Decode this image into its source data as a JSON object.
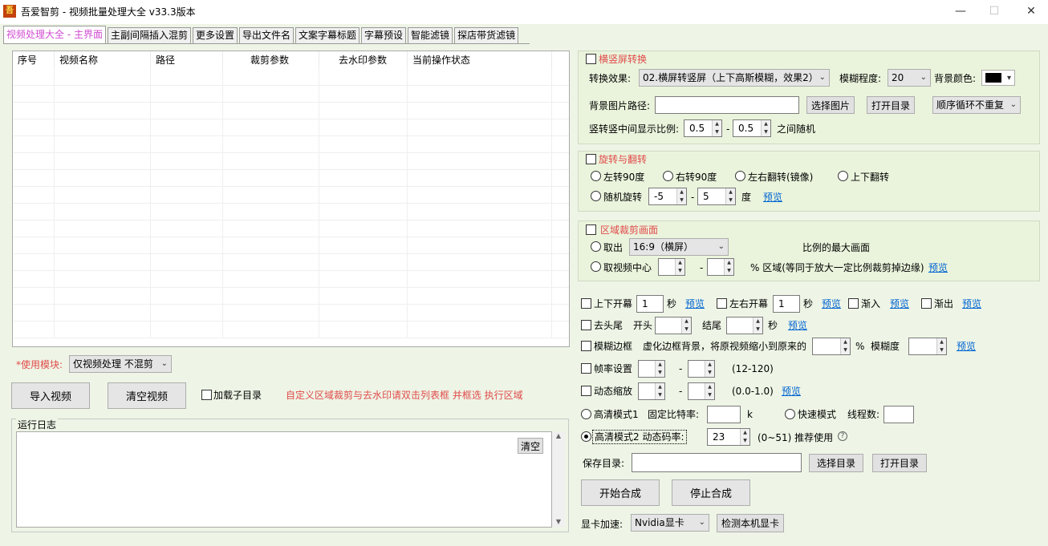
{
  "window": {
    "title": "吾爱智剪 -  视频批量处理大全  v33.3版本",
    "logo": "吾",
    "min": "—",
    "max": "☐",
    "close": "✕"
  },
  "tabs": [
    "视频处理大全 - 主界面",
    "主副间隔插入混剪",
    "更多设置",
    "导出文件名",
    "文案字幕标题",
    "字幕预设",
    "智能滤镜",
    "探店带货滤镜"
  ],
  "table": {
    "columns": [
      "序号",
      "视频名称",
      "路径",
      "裁剪参数",
      "去水印参数",
      "当前操作状态"
    ]
  },
  "left": {
    "module_label": "*使用模块:",
    "module_value": "仅视频处理 不混剪",
    "import_btn": "导入视频",
    "clear_btn": "清空视频",
    "subdir_label": "加载子目录",
    "hint": "自定义区域裁剪与去水印请双击列表框 并框选 执行区域",
    "log_title": "运行日志",
    "log_clear": "清空"
  },
  "g1": {
    "title": "横竖屏转换",
    "effect_label": "转换效果:",
    "effect_value": "02.横屏转竖屏（上下高斯模糊，效果2）",
    "blur_label": "模糊程度:",
    "blur_value": "20",
    "bg_color_label": "背景颜色:",
    "bg_path_label": "背景图片路径:",
    "choose_img": "选择图片",
    "open_dir": "打开目录",
    "loop_value": "顺序循环不重复",
    "ratio_label": "竖转竖中间显示比例:",
    "ratio_a": "0.5",
    "dash": "-",
    "ratio_b": "0.5",
    "ratio_suffix": "之间随机"
  },
  "g2": {
    "title": "旋转与翻转",
    "left90": "左转90度",
    "right90": "右转90度",
    "mirror": "左右翻转(镜像)",
    "flip": "上下翻转",
    "random": "随机旋转",
    "ra": "-5",
    "dash": "-",
    "rb": "5",
    "deg": "度",
    "preview": "预览"
  },
  "g3": {
    "title": "区域裁剪画面",
    "take": "取出",
    "ratio_value": "16:9（横屏）",
    "max_label": "比例的最大画面",
    "center": "取视频中心",
    "dash": "-",
    "pct_label": "% 区域(等同于放大一定比例裁剪掉边缘)",
    "preview": "预览"
  },
  "opts": {
    "open_ud": "上下开幕",
    "open_ud_v": "1",
    "sec": "秒",
    "preview": "预览",
    "open_lr": "左右开幕",
    "open_lr_v": "1",
    "fade_in": "渐入",
    "fade_out": "渐出",
    "trim": "去头尾",
    "head": "开头",
    "tail": "结尾",
    "blur_border": "模糊边框",
    "blur_desc": "虚化边框背景，将原视频缩小到原来的",
    "pct": "%",
    "blur_deg": "模糊度",
    "fps": "帧率设置",
    "dash": "-",
    "fps_range": "(12-120)",
    "zoom": "动态缩放",
    "zoom_range": "(0.0-1.0)",
    "hd1": "高清模式1",
    "fixed_rate": "固定比特率:",
    "k": "k",
    "fast": "快速模式",
    "threads": "线程数:",
    "hd2": "高清模式2  动态码率:",
    "hd2_v": "23",
    "hd2_range": "(0~51)  推荐使用",
    "help": "?",
    "save_label": "保存目录:",
    "choose_dir": "选择目录",
    "open_dir": "打开目录",
    "start": "开始合成",
    "stop": "停止合成",
    "gpu_label": "显卡加速:",
    "gpu_value": "Nvidia显卡",
    "detect_gpu": "检测本机显卡"
  }
}
